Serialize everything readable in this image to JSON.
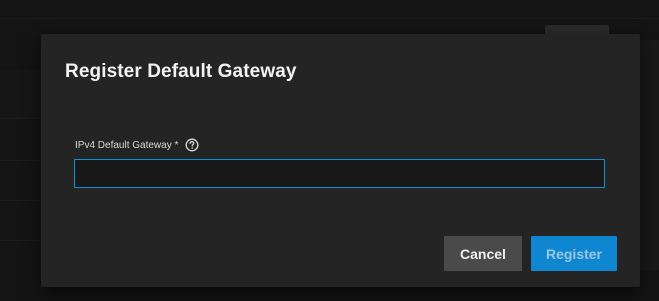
{
  "dialog": {
    "title": "Register Default Gateway",
    "field": {
      "label": "IPv4 Default Gateway *",
      "value": "",
      "help_icon": "help-circle-icon"
    },
    "actions": {
      "cancel_label": "Cancel",
      "register_label": "Register"
    }
  },
  "colors": {
    "dialog_bg": "#242424",
    "input_focus_border": "#1a8ed2",
    "primary_button": "#0f87d0",
    "secondary_button": "#4a4a4a"
  }
}
